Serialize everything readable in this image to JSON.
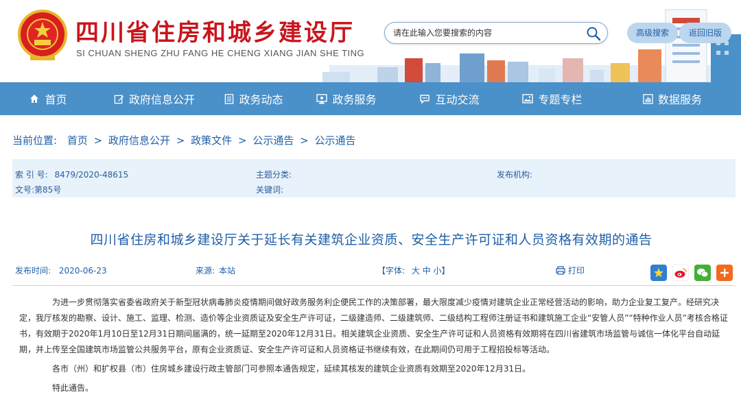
{
  "header": {
    "site_title": "四川省住房和城乡建设厅",
    "site_pinyin": "SI CHUAN SHENG ZHU FANG HE CHENG XIANG JIAN SHE TING",
    "search_placeholder": "请在此输入您要搜索的内容",
    "advanced_search": "高级搜索",
    "old_version": "返回旧版"
  },
  "nav": {
    "items": [
      {
        "label": "首页",
        "icon": "home-icon"
      },
      {
        "label": "政府信息公开",
        "icon": "edit-icon"
      },
      {
        "label": "政务动态",
        "icon": "document-icon"
      },
      {
        "label": "政务服务",
        "icon": "monitor-icon"
      },
      {
        "label": "互动交流",
        "icon": "chat-icon"
      },
      {
        "label": "专题专栏",
        "icon": "image-icon"
      },
      {
        "label": "数据服务",
        "icon": "data-icon"
      }
    ]
  },
  "breadcrumb": {
    "label": "当前位置:",
    "items": [
      "首页",
      "政府信息公开",
      "政策文件",
      "公示通告",
      "公示通告"
    ]
  },
  "meta": {
    "index_label": "索 引 号:",
    "index_value": "8479/2020-48615",
    "doc_label": "文号:",
    "doc_value": "第85号",
    "topic_label": "主题分类:",
    "keyword_label": "关键词:",
    "publisher_label": "发布机构:"
  },
  "article": {
    "title": "四川省住房和城乡建设厅关于延长有关建筑企业资质、安全生产许可证和人员资格有效期的通告",
    "publish_label": "发布时间:",
    "publish_date": "2020-06-23",
    "source_label": "来源:",
    "source_value": "本站",
    "font_label": "【字体:",
    "font_sizes": "大 中 小】",
    "print_label": "打印",
    "paragraphs": [
      "为进一步贯彻落实省委省政府关于新型冠状病毒肺炎疫情期间做好政务服务利企便民工作的决策部署，最大限度减少疫情对建筑企业正常经营活动的影响，助力企业复工复产。经研究决定，我厅核发的勘察、设计、施工、监理、检测、造价等企业资质证及安全生产许可证，二级建造师、二级建筑师、二级结构工程师注册证书和建筑施工企业“安管人员”“特种作业人员”考核合格证书，有效期于2020年1月10日至12月31日期间届满的，统一延期至2020年12月31日。相关建筑企业资质、安全生产许可证和人员资格有效期将在四川省建筑市场监管与诚信一体化平台自动延期，并上传至全国建筑市场监管公共服务平台，原有企业资质证、安全生产许可证和人员资格证书继续有效，在此期间仍可用于工程招投标等活动。",
      "各市（州）和扩权县（市）住房城乡建设行政主管部门可参照本通告规定，延续其核发的建筑企业资质有效期至2020年12月31日。",
      "特此通告。"
    ]
  },
  "share": [
    "favorite-icon",
    "weibo-icon",
    "wechat-icon",
    "more-icon"
  ],
  "colors": {
    "brand_red": "#c8161d",
    "nav_blue": "#4a90c9",
    "link_blue": "#1f5fa8",
    "meta_bg": "#e8f2fb"
  }
}
